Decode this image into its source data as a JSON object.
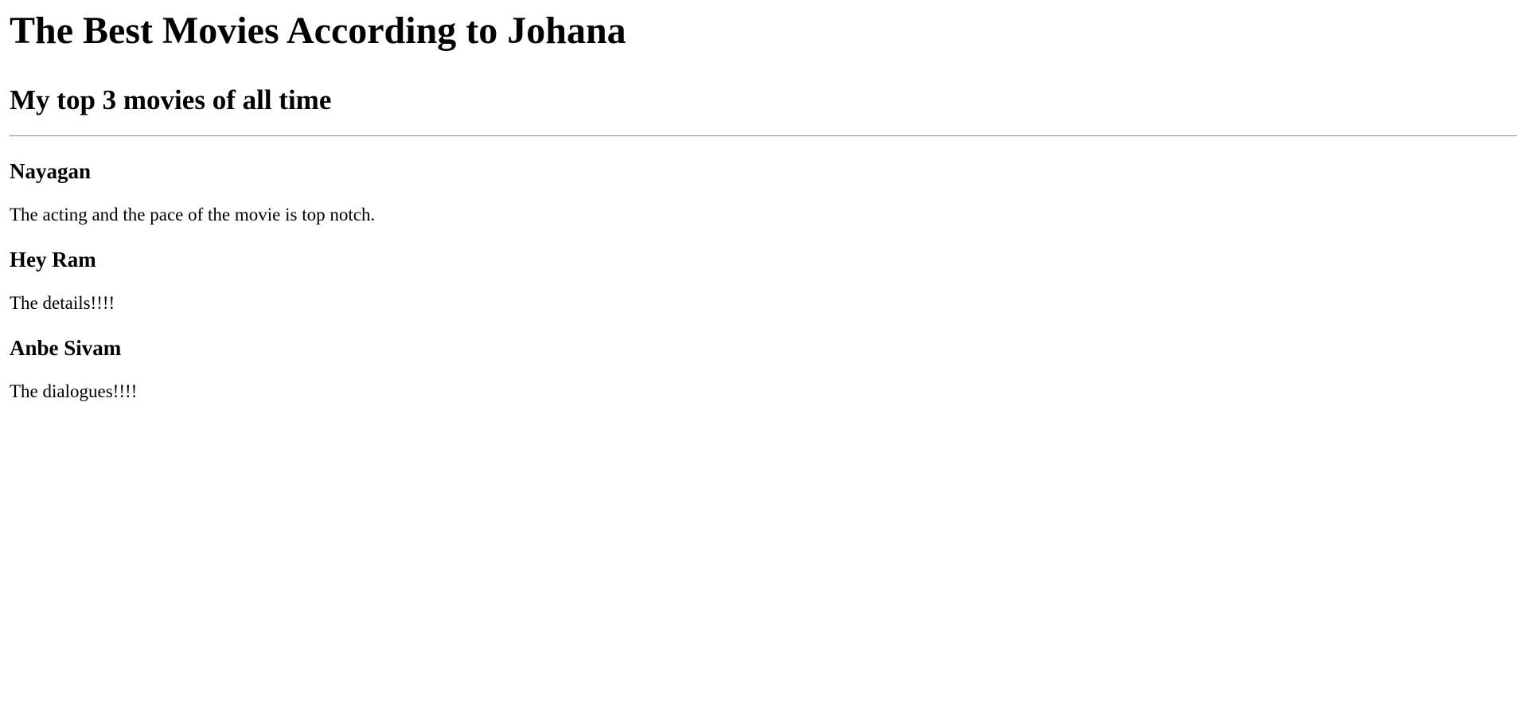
{
  "page": {
    "title": "The Best Movies According to Johana",
    "subtitle": "My top 3 movies of all time"
  },
  "movies": [
    {
      "name": "Nayagan",
      "review": "The acting and the pace of the movie is top notch."
    },
    {
      "name": "Hey Ram",
      "review": "The details!!!!"
    },
    {
      "name": "Anbe Sivam",
      "review": "The dialogues!!!!"
    }
  ]
}
